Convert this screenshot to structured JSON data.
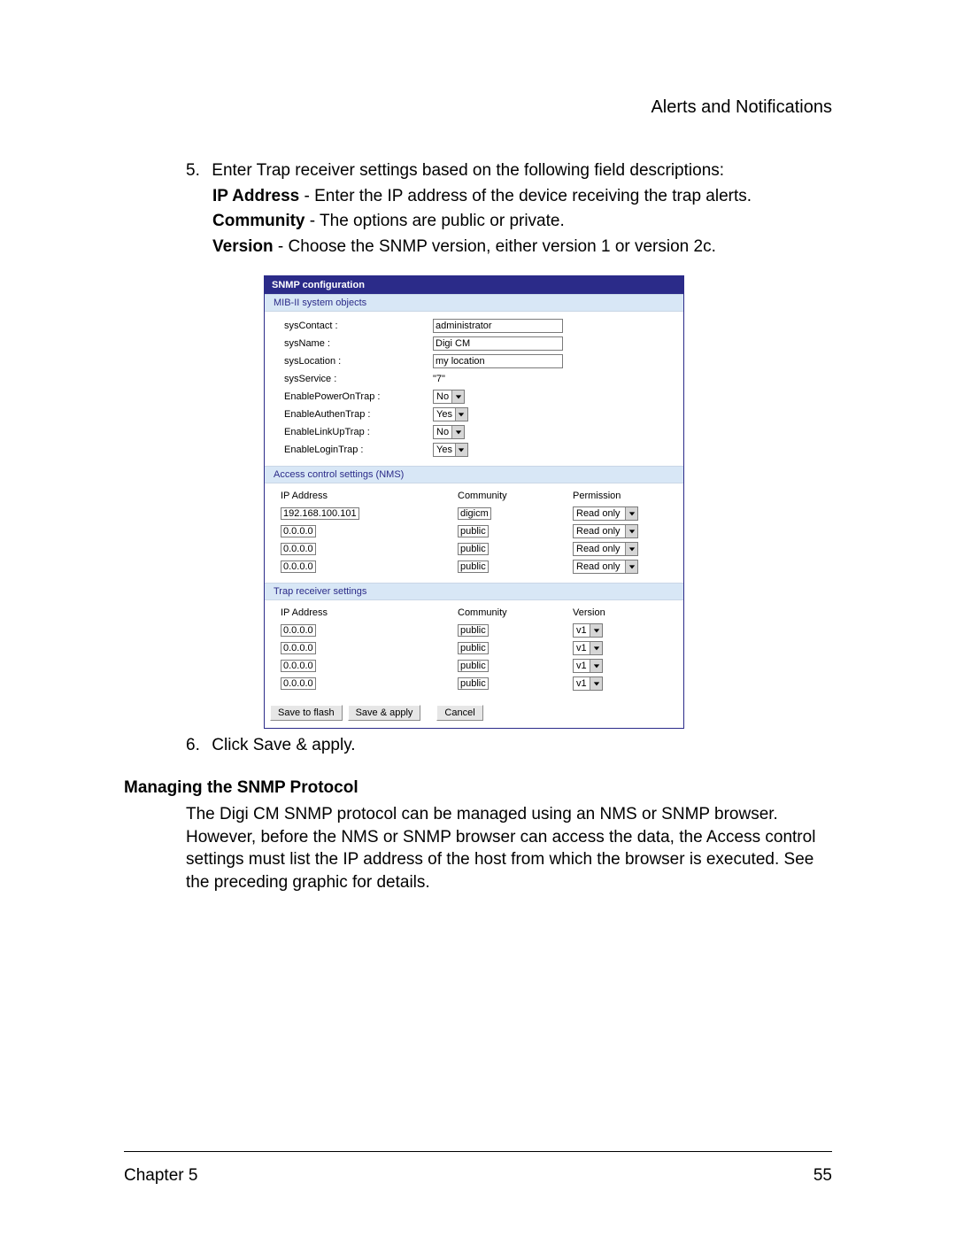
{
  "header": {
    "title": "Alerts and Notifications"
  },
  "step5": {
    "num": "5.",
    "line1": "Enter Trap receiver settings based on the following field descriptions:",
    "ip_label": "IP Address",
    "ip_text": " - Enter the IP address of the device receiving the trap alerts.",
    "comm_label": "Community",
    "comm_text": " - The options are public or private.",
    "ver_label": "Version",
    "ver_text": " - Choose the SNMP version, either version 1 or version 2c."
  },
  "panel": {
    "title": "SNMP configuration",
    "mib_header": "MIB-II system objects",
    "labels": {
      "sysContact": "sysContact :",
      "sysName": "sysName :",
      "sysLocation": "sysLocation :",
      "sysService": "sysService :",
      "powerOn": "EnablePowerOnTrap :",
      "authen": "EnableAuthenTrap :",
      "linkup": "EnableLinkUpTrap :",
      "login": "EnableLoginTrap :"
    },
    "values": {
      "sysContact": "administrator",
      "sysName": "Digi CM",
      "sysLocation": "my location",
      "sysService": "\"7\"",
      "powerOn": "No",
      "authen": "Yes",
      "linkup": "No",
      "login": "Yes"
    },
    "acs_header": "Access control settings (NMS)",
    "acs_cols": {
      "ip": "IP Address",
      "comm": "Community",
      "perm": "Permission"
    },
    "acs_rows": [
      {
        "ip": "192.168.100.101",
        "comm": "digicm",
        "perm": "Read only"
      },
      {
        "ip": "0.0.0.0",
        "comm": "public",
        "perm": "Read only"
      },
      {
        "ip": "0.0.0.0",
        "comm": "public",
        "perm": "Read only"
      },
      {
        "ip": "0.0.0.0",
        "comm": "public",
        "perm": "Read only"
      }
    ],
    "trap_header": "Trap receiver settings",
    "trap_cols": {
      "ip": "IP Address",
      "comm": "Community",
      "ver": "Version"
    },
    "trap_rows": [
      {
        "ip": "0.0.0.0",
        "comm": "public",
        "ver": "v1"
      },
      {
        "ip": "0.0.0.0",
        "comm": "public",
        "ver": "v1"
      },
      {
        "ip": "0.0.0.0",
        "comm": "public",
        "ver": "v1"
      },
      {
        "ip": "0.0.0.0",
        "comm": "public",
        "ver": "v1"
      }
    ],
    "buttons": {
      "flash": "Save to flash",
      "apply": "Save & apply",
      "cancel": "Cancel"
    }
  },
  "step6": {
    "num": "6.",
    "pre": "Click ",
    "btn": "Save & apply",
    "post": "."
  },
  "subhead": "Managing the SNMP Protocol",
  "para": "The Digi CM SNMP protocol can be managed using an NMS or SNMP browser. However, before the NMS or SNMP browser can access the data, the Access control settings must list the IP address of the host from which the browser is executed. See the preceding graphic for details.",
  "footer": {
    "left": "Chapter 5",
    "right": "55"
  }
}
